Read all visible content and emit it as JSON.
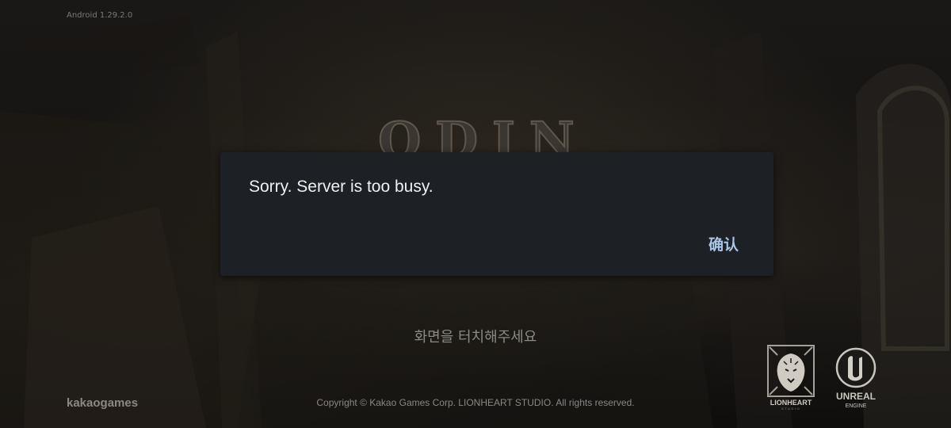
{
  "app": {
    "version_label": "Android 1.29.2.0",
    "title_logo_text": "ODIN"
  },
  "dialog": {
    "message": "Sorry. Server is too busy.",
    "confirm_label": "确认"
  },
  "screen": {
    "touch_prompt": "화면을 터치해주세요",
    "copyright": "Copyright © Kakao Games Corp. LIONHEART STUDIO. All rights reserved.",
    "publisher_logo_text": "kakaogames"
  },
  "logos": {
    "lionheart_name": "LIONHEART",
    "lionheart_sub": "STUDIO",
    "unreal_line1": "UNREAL",
    "unreal_line2": "ENGINE"
  },
  "colors": {
    "dialog_bg": "#1d2125",
    "confirm_text": "#a9c6e6",
    "background": "#121110"
  }
}
